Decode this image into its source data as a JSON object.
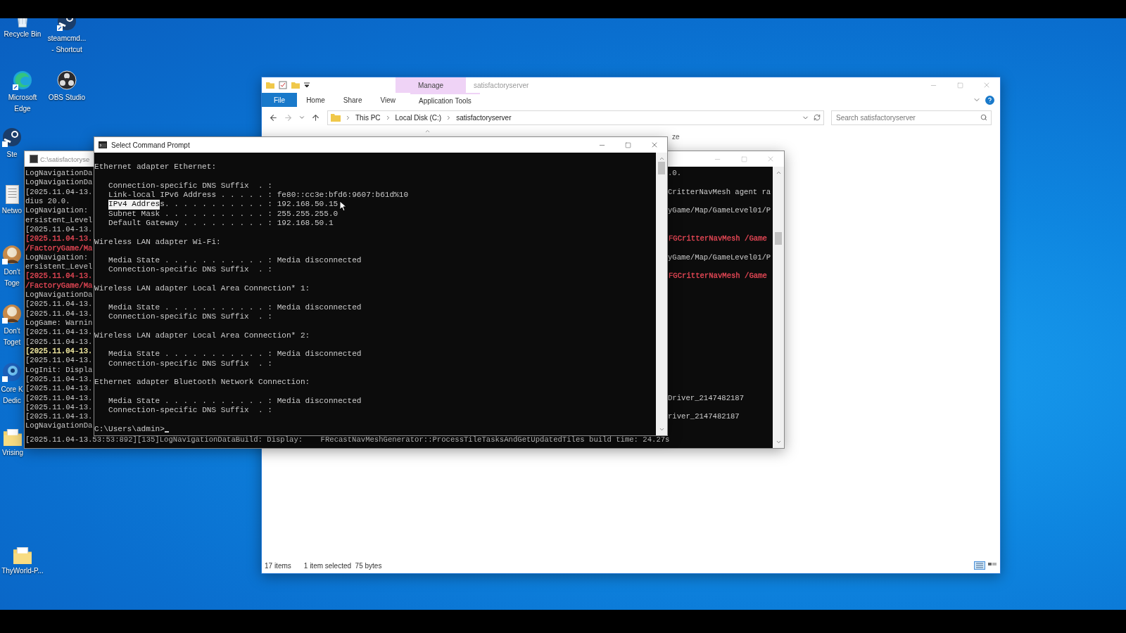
{
  "desktop_icons": [
    {
      "kind": "recycle",
      "lines": [
        "Recycle Bin"
      ]
    },
    {
      "kind": "steamcmd",
      "lines": [
        "steamcmd...",
        "- Shortcut"
      ]
    },
    {
      "kind": "edge",
      "lines": [
        "Microsoft",
        "Edge"
      ]
    },
    {
      "kind": "obs",
      "lines": [
        "OBS Studio"
      ]
    },
    {
      "kind": "steam",
      "lines": [
        "Ste"
      ]
    },
    {
      "kind": "network",
      "lines": [
        "Netwo"
      ]
    },
    {
      "kind": "figure",
      "lines": [
        "Don't",
        "Toge"
      ]
    },
    {
      "kind": "figure",
      "lines": [
        "Don't",
        "Toget"
      ]
    },
    {
      "kind": "orb",
      "lines": [
        "Core K",
        "Dedic"
      ]
    },
    {
      "kind": "folder",
      "lines": [
        "Vrising"
      ]
    },
    {
      "kind": "folder",
      "lines": [
        "ThyWorld-P..."
      ]
    }
  ],
  "explorer": {
    "context_tab": "Manage",
    "title": "satisfactoryserver",
    "tabs": [
      {
        "label": "File",
        "kind": "file"
      },
      {
        "label": "Home",
        "kind": "plain"
      },
      {
        "label": "Share",
        "kind": "plain"
      },
      {
        "label": "View",
        "kind": "plain"
      },
      {
        "label": "Application Tools",
        "kind": "context"
      }
    ],
    "path": [
      "This PC",
      "Local Disk (C:)",
      "satisfactoryserver"
    ],
    "search": {
      "placeholder": "Search satisfactoryserver"
    },
    "column_header": "ze",
    "status": {
      "count": "17 items",
      "selection": "1 item selected  75 bytes"
    }
  },
  "background_console": {
    "title": "C:\\satisfactoryse",
    "rows": [
      {
        "left": "LogNavigationDa",
        "right": ".0."
      },
      {
        "left": "LogNavigationDa"
      },
      {
        "left": "[2025.11.04-13.",
        "right": "CritterNavMesh agent ra"
      },
      {
        "left": "dius 20.0."
      },
      {
        "left": "LogNavigation:",
        "right": "yGame/Map/GameLevel01/P"
      },
      {
        "left": "ersistent_Level"
      },
      {
        "left": "[2025.11.04-13."
      },
      {
        "left": "[2025.11.04-13.",
        "right": "FGCritterNavMesh /Game",
        "color": "#e74856"
      },
      {
        "left": "/FactoryGame/Ma",
        "color": "#e74856"
      },
      {
        "left": "LogNavigation:",
        "right": "yGame/Map/GameLevel01/P"
      },
      {
        "left": "ersistent_Level"
      },
      {
        "left": "[2025.11.04-13.",
        "right": "FGCritterNavMesh /Game",
        "color": "#e74856"
      },
      {
        "left": "/FactoryGame/Ma",
        "color": "#e74856"
      },
      {
        "left": "LogNavigationDa"
      },
      {
        "left": "[2025.11.04-13."
      },
      {
        "left": "[2025.11.04-13."
      },
      {
        "left": "LogGame: Warnin"
      },
      {
        "left": "[2025.11.04-13."
      },
      {
        "left": "[2025.11.04-13."
      },
      {
        "left": "[2025.11.04-13.",
        "color": "#f9f1a5"
      },
      {
        "left": "[2025.11.04-13."
      },
      {
        "left": "LogInit: Displa"
      },
      {
        "left": "[2025.11.04-13."
      },
      {
        "left": "[2025.11.04-13."
      },
      {
        "left": "[2025.11.04-13.",
        "right": "Driver_2147482187"
      },
      {
        "left": "[2025.11.04-13."
      },
      {
        "left": "[2025.11.04-13.",
        "right": "river_2147482187"
      },
      {
        "left": "LogNavigationDa"
      }
    ],
    "last_line": "[2025.11.04-13.53:53:892][135]LogNavigationDataBuild: Display:    FRecastNavMeshGenerator::ProcessTileTasksAndGetUpdatedTiles build time: 24.27s"
  },
  "command_prompt": {
    "title": "Select Command Prompt",
    "sections": [
      {
        "heading": "Ethernet adapter Ethernet:",
        "entries": [
          {
            "text": "Connection-specific DNS Suffix  . :"
          },
          {
            "text": "Link-local IPv6 Address . . . . . : fe80::cc3e:bfd6:9607:b61d%10"
          },
          {
            "selected_text": "IPv4 Addres",
            "text": "s. . . . . . . . . . . : 192.168.50.15"
          },
          {
            "text": "Subnet Mask . . . . . . . . . . . : 255.255.255.0"
          },
          {
            "text": "Default Gateway . . . . . . . . . : 192.168.50.1"
          }
        ]
      },
      {
        "heading": "Wireless LAN adapter Wi-Fi:",
        "entries": [
          {
            "text": "Media State . . . . . . . . . . . : Media disconnected"
          },
          {
            "text": "Connection-specific DNS Suffix  . :"
          }
        ]
      },
      {
        "heading": "Wireless LAN adapter Local Area Connection* 1:",
        "entries": [
          {
            "text": "Media State . . . . . . . . . . . : Media disconnected"
          },
          {
            "text": "Connection-specific DNS Suffix  . :"
          }
        ]
      },
      {
        "heading": "Wireless LAN adapter Local Area Connection* 2:",
        "entries": [
          {
            "text": "Media State . . . . . . . . . . . : Media disconnected"
          },
          {
            "text": "Connection-specific DNS Suffix  . :"
          }
        ]
      },
      {
        "heading": "Ethernet adapter Bluetooth Network Connection:",
        "entries": [
          {
            "text": "Media State . . . . . . . . . . . : Media disconnected"
          },
          {
            "text": "Connection-specific DNS Suffix  . :"
          }
        ]
      }
    ],
    "prompt": "C:\\Users\\admin>"
  }
}
